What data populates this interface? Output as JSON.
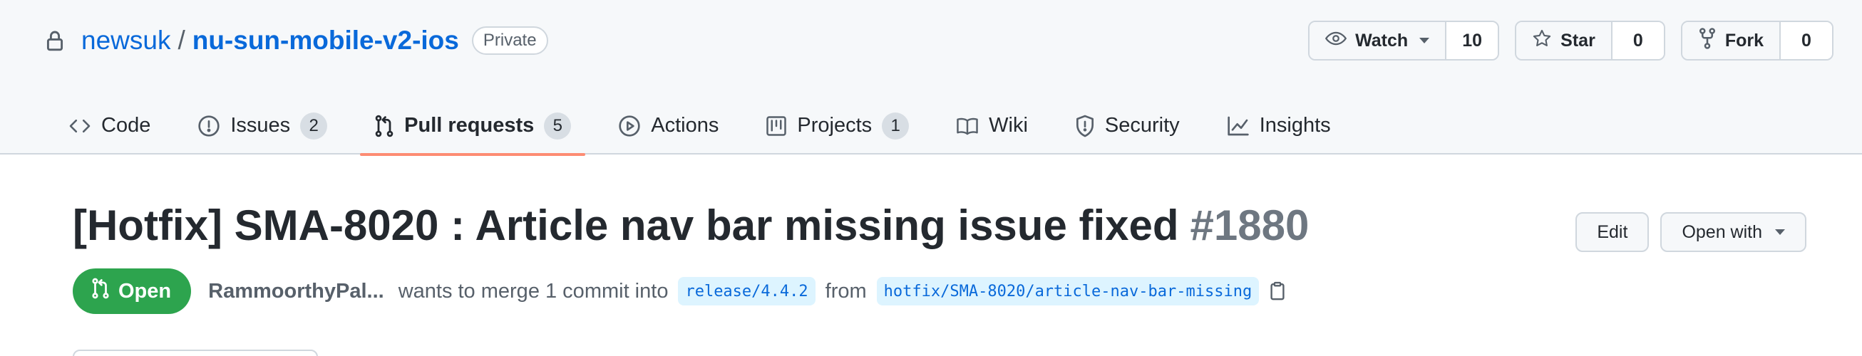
{
  "repo": {
    "owner": "newsuk",
    "separator": "/",
    "name": "nu-sun-mobile-v2-ios",
    "visibility": "Private"
  },
  "actions": {
    "watch": {
      "label": "Watch",
      "count": "10",
      "icon": "eye-icon"
    },
    "star": {
      "label": "Star",
      "count": "0",
      "icon": "star-icon"
    },
    "fork": {
      "label": "Fork",
      "count": "0",
      "icon": "repo-forked-icon"
    }
  },
  "nav": {
    "tabs": [
      {
        "label": "Code",
        "icon": "code-icon"
      },
      {
        "label": "Issues",
        "count": "2",
        "icon": "issue-opened-icon"
      },
      {
        "label": "Pull requests",
        "count": "5",
        "icon": "git-pull-request-icon",
        "selected": true
      },
      {
        "label": "Actions",
        "icon": "play-icon"
      },
      {
        "label": "Projects",
        "count": "1",
        "icon": "project-icon"
      },
      {
        "label": "Wiki",
        "icon": "book-icon"
      },
      {
        "label": "Security",
        "icon": "shield-icon"
      },
      {
        "label": "Insights",
        "icon": "graph-icon"
      }
    ]
  },
  "pr": {
    "title": "[Hotfix] SMA-8020 : Article nav bar missing issue fixed",
    "number": "#1880",
    "edit_label": "Edit",
    "open_with_label": "Open with",
    "state": "Open",
    "author": "RammoorthyPal...",
    "merge_text": "wants to merge 1 commit into",
    "base_branch": "release/4.4.2",
    "from_text": "from",
    "head_branch": "hotfix/SMA-8020/article-nav-bar-missing"
  },
  "colors": {
    "link": "#0969da",
    "open_green": "#2da44e",
    "tab_underline": "#fd8c73",
    "header_bg": "#f6f8fa"
  }
}
